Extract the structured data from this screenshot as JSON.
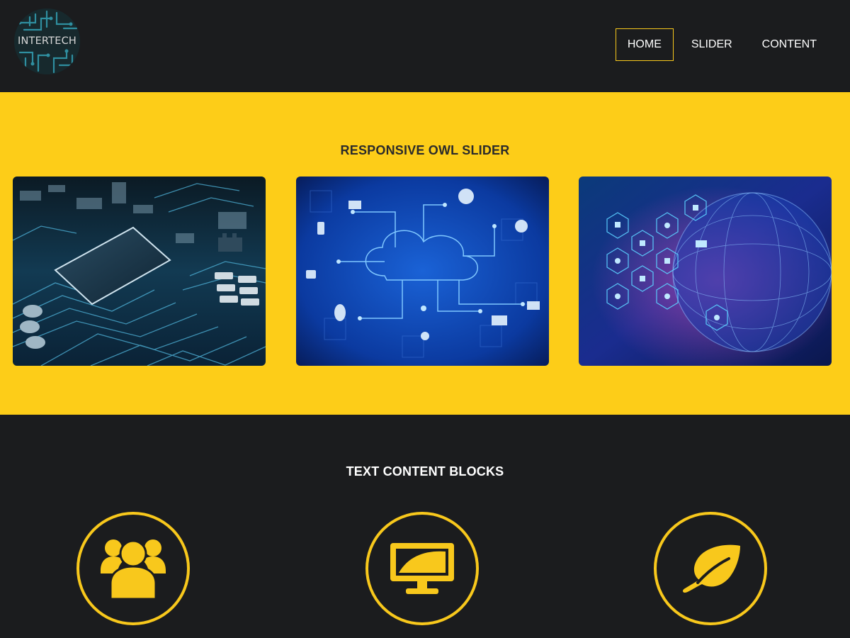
{
  "brand": {
    "logo_text": "INTERTECH"
  },
  "nav": {
    "items": [
      {
        "label": "HOME",
        "active": true
      },
      {
        "label": "SLIDER",
        "active": false
      },
      {
        "label": "CONTENT",
        "active": false
      }
    ]
  },
  "slider": {
    "title": "RESPONSIVE OWL SLIDER",
    "slides": [
      {
        "image": "circuit-board-chip"
      },
      {
        "image": "cloud-network"
      },
      {
        "image": "digital-globe"
      }
    ]
  },
  "content": {
    "title": "TEXT CONTENT BLOCKS",
    "features": [
      {
        "icon": "users-icon"
      },
      {
        "icon": "monitor-icon"
      },
      {
        "icon": "leaf-icon"
      }
    ]
  },
  "colors": {
    "accent": "#fdcd18",
    "dark": "#1b1c1e",
    "title_on_accent": "#2b2b2b"
  }
}
